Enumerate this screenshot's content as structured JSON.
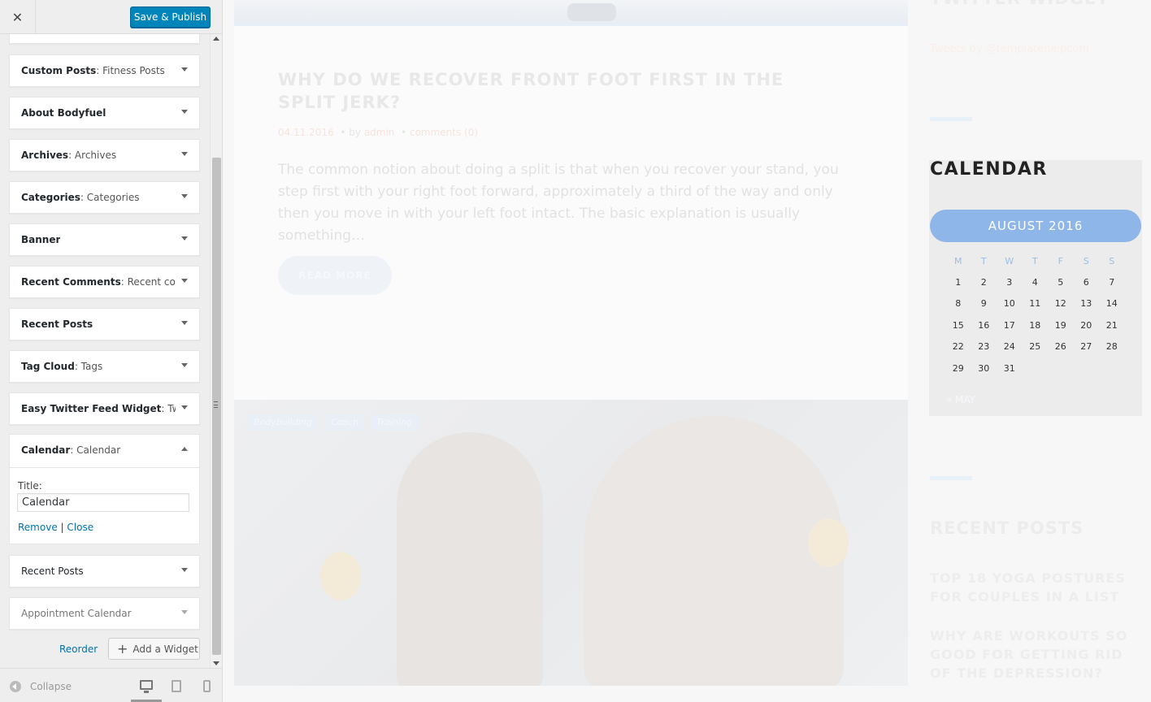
{
  "sidebar": {
    "close_label": "✕",
    "save_label": "Save & Publish",
    "widgets": [
      {
        "name": "Custom Posts",
        "instance": ": Fitness Posts"
      },
      {
        "name": "About Bodyfuel",
        "instance": ""
      },
      {
        "name": "Archives",
        "instance": ": Archives"
      },
      {
        "name": "Categories",
        "instance": ": Categories"
      },
      {
        "name": "Banner",
        "instance": ""
      },
      {
        "name": "Recent Comments",
        "instance": ": Recent co..."
      },
      {
        "name": "Recent Posts",
        "instance": ""
      },
      {
        "name": "Tag Cloud",
        "instance": ": Tags"
      },
      {
        "name": "Easy Twitter Feed Widget",
        "instance": ": Twi..."
      }
    ],
    "open_widget": {
      "name": "Calendar",
      "instance": ": Calendar",
      "title_label": "Title:",
      "title_value": "Calendar",
      "remove_label": "Remove",
      "separator": "|",
      "close_label": "Close"
    },
    "widgets_after": [
      {
        "name": "Recent Posts",
        "instance": ""
      },
      {
        "name": "Appointment Calendar",
        "instance": ""
      }
    ],
    "reorder_label": "Reorder",
    "add_widget_label": "Add a Widget",
    "collapse_label": "Collapse"
  },
  "preview": {
    "post": {
      "title": "WHY DO WE RECOVER FRONT FOOT FIRST IN THE SPLIT JERK?",
      "date": "04.11.2016",
      "by": "by",
      "author": "admin",
      "comments": "comments (0)",
      "excerpt": "The common notion about doing a split is that when you recover your stand, you step first with your right foot forward, approximately a third of the way and only then you move in with your left foot intact. The basic explanation is usually something…",
      "read_more": "READ MORE"
    },
    "tags": [
      "Bodybuilding",
      "Coach",
      "Training"
    ],
    "twitter": {
      "title": "TWITTER WIDGET",
      "link": "Tweets by @templatehelpcom"
    },
    "calendar": {
      "title": "CALENDAR",
      "month": "AUGUST 2016",
      "weekdays": [
        "M",
        "T",
        "W",
        "T",
        "F",
        "S",
        "S"
      ],
      "weeks": [
        [
          "1",
          "2",
          "3",
          "4",
          "5",
          "6",
          "7"
        ],
        [
          "8",
          "9",
          "10",
          "11",
          "12",
          "13",
          "14"
        ],
        [
          "15",
          "16",
          "17",
          "18",
          "19",
          "20",
          "21"
        ],
        [
          "22",
          "23",
          "24",
          "25",
          "26",
          "27",
          "28"
        ],
        [
          "29",
          "30",
          "31",
          "",
          "",
          "",
          ""
        ]
      ],
      "prev_link": "« MAY"
    },
    "recent_posts": {
      "title": "RECENT POSTS",
      "items": [
        "TOP 18 YOGA POSTURES FOR COUPLES IN A LIST",
        "WHY ARE WORKOUTS SO GOOD FOR GETTING RID OF THE DEPRESSION?"
      ]
    }
  },
  "colors": {
    "primary_button": "#0085ba",
    "link": "#0073aa",
    "calendar_header": "#8eb6e8"
  }
}
